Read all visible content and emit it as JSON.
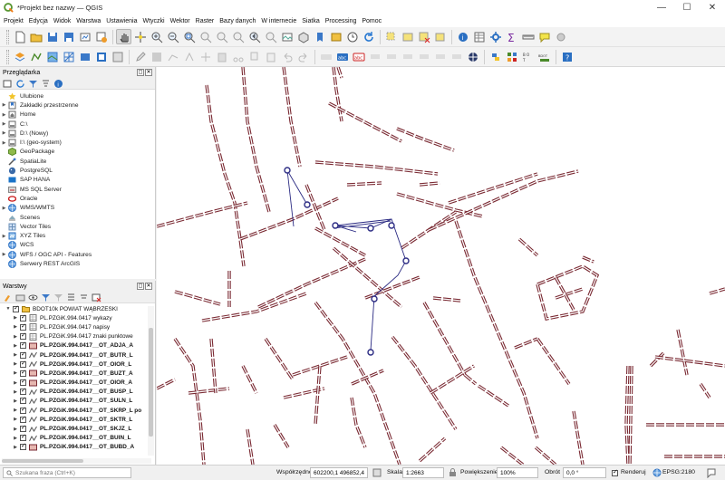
{
  "window": {
    "title": "*Projekt bez nazwy — QGIS",
    "minimize": "—",
    "maximize": "☐",
    "close": "✕"
  },
  "menu": [
    "Projekt",
    "Edycja",
    "Widok",
    "Warstwa",
    "Ustawienia",
    "Wtyczki",
    "Wektor",
    "Raster",
    "Bazy danych",
    "W internecie",
    "Siatka",
    "Processing",
    "Pomoc"
  ],
  "toolbar_icons": [
    "new-project",
    "open-project",
    "save-project",
    "save-as",
    "print-layout",
    "layout-manager",
    "pan",
    "pan-to-selection",
    "zoom-in",
    "zoom-out",
    "zoom-full",
    "zoom-selection",
    "zoom-layer",
    "zoom-native",
    "zoom-last",
    "zoom-next",
    "new-map-view",
    "new-3d-view",
    "bookmark-new",
    "bookmark-show",
    "refresh",
    "select-features",
    "deselect",
    "select-by-value",
    "identify",
    "measure",
    "statistics",
    "sum",
    "attribute-table",
    "text-annotation",
    "settings"
  ],
  "browser": {
    "title": "Przeglądarka",
    "items": [
      {
        "label": "Ulubione",
        "icon": "star",
        "arrow": ""
      },
      {
        "label": "Zakładki przestrzenne",
        "icon": "bookmark",
        "arrow": "▶"
      },
      {
        "label": "Home",
        "icon": "home",
        "arrow": "▶"
      },
      {
        "label": "C:\\",
        "icon": "drive",
        "arrow": "▶"
      },
      {
        "label": "D:\\ (Nowy)",
        "icon": "drive",
        "arrow": "▶"
      },
      {
        "label": "I:\\ (geo-system)",
        "icon": "drive",
        "arrow": "▶"
      },
      {
        "label": "GeoPackage",
        "icon": "geopackage",
        "arrow": ""
      },
      {
        "label": "SpatiaLite",
        "icon": "spatialite",
        "arrow": ""
      },
      {
        "label": "PostgreSQL",
        "icon": "postgres",
        "arrow": ""
      },
      {
        "label": "SAP HANA",
        "icon": "hana",
        "arrow": ""
      },
      {
        "label": "MS SQL Server",
        "icon": "mssql",
        "arrow": ""
      },
      {
        "label": "Oracle",
        "icon": "oracle",
        "arrow": ""
      },
      {
        "label": "WMS/WMTS",
        "icon": "globe",
        "arrow": "▶"
      },
      {
        "label": "Scenes",
        "icon": "scenes",
        "arrow": ""
      },
      {
        "label": "Vector Tiles",
        "icon": "vectortiles",
        "arrow": ""
      },
      {
        "label": "XYZ Tiles",
        "icon": "xyz",
        "arrow": "▶"
      },
      {
        "label": "WCS",
        "icon": "globe",
        "arrow": ""
      },
      {
        "label": "WFS / OGC API - Features",
        "icon": "globe",
        "arrow": "▶"
      },
      {
        "label": "Serwery REST ArcGIS",
        "icon": "globe",
        "arrow": ""
      }
    ]
  },
  "layers": {
    "title": "Warstwy",
    "items": [
      {
        "label": "BDOT10k POWIAT WĄBRZESKI",
        "type": "group",
        "arrow": "▼",
        "bold": false
      },
      {
        "label": "PL.PZGiK.994.0417 wykazy",
        "type": "table",
        "arrow": "▶",
        "bold": false
      },
      {
        "label": "PL.PZGiK.994.0417 napisy",
        "type": "table",
        "arrow": "▶",
        "bold": false
      },
      {
        "label": "PL.PZGiK.994.0417 znaki punktowe",
        "type": "table",
        "arrow": "▶",
        "bold": false
      },
      {
        "label": "PL.PZGiK.994.0417__OT_ADJA_A",
        "type": "polygon",
        "arrow": "▶",
        "bold": true
      },
      {
        "label": "PL.PZGiK.994.0417__OT_BUTR_L",
        "type": "line",
        "arrow": "▶",
        "bold": true
      },
      {
        "label": "PL.PZGiK.994.0417__OT_OIOR_L",
        "type": "line",
        "arrow": "▶",
        "bold": true
      },
      {
        "label": "PL.PZGiK.994.0417__OT_BUZT_A",
        "type": "polygon",
        "arrow": "▶",
        "bold": true
      },
      {
        "label": "PL.PZGiK.994.0417__OT_OIOR_A",
        "type": "polygon",
        "arrow": "▶",
        "bold": true
      },
      {
        "label": "PL.PZGiK.994.0417__OT_BUSP_L",
        "type": "line",
        "arrow": "▶",
        "bold": true
      },
      {
        "label": "PL.PZGiK.994.0417__OT_SULN_L",
        "type": "line",
        "arrow": "▶",
        "bold": true
      },
      {
        "label": "PL.PZGiK.994.0417__OT_SKRP_L po",
        "type": "line",
        "arrow": "▶",
        "bold": true
      },
      {
        "label": "PL.PZGiK.994.0417__OT_SKTR_L",
        "type": "line",
        "arrow": "▶",
        "bold": true
      },
      {
        "label": "PL.PZGiK.994.0417__OT_SKJZ_L",
        "type": "line",
        "arrow": "▶",
        "bold": true
      },
      {
        "label": "PL.PZGiK.994.0417__OT_BUIN_L",
        "type": "line",
        "arrow": "▶",
        "bold": true
      },
      {
        "label": "PL.PZGiK.994.0417__OT_BUBD_A",
        "type": "polygon",
        "arrow": "▶",
        "bold": true
      }
    ]
  },
  "status": {
    "search_placeholder": "Szukana fraza (Ctrl+K)",
    "coord_label": "Współrzędne",
    "coord_value": "602200,1  496852,4",
    "scale_label": "Skala",
    "scale_value": "1:2663",
    "magnifier_label": "Powiększenie",
    "magnifier_value": "100%",
    "rotation_label": "Obrót",
    "rotation_value": "0,0 °",
    "render_label": "Renderuj",
    "crs_label": "EPSG:2180"
  },
  "colors": {
    "road": "#7a2a33",
    "track": "#2b2b83",
    "accent": "#4a8a2a"
  }
}
